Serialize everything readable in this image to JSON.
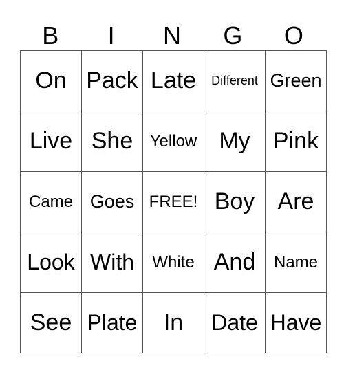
{
  "header": [
    "B",
    "I",
    "N",
    "G",
    "O"
  ],
  "rows": [
    [
      "On",
      "Pack",
      "Late",
      "Different",
      "Green"
    ],
    [
      "Live",
      "She",
      "Yellow",
      "My",
      "Pink"
    ],
    [
      "Came",
      "Goes",
      "FREE!",
      "Boy",
      "Are"
    ],
    [
      "Look",
      "With",
      "White",
      "And",
      "Name"
    ],
    [
      "See",
      "Plate",
      "In",
      "Date",
      "Have"
    ]
  ]
}
